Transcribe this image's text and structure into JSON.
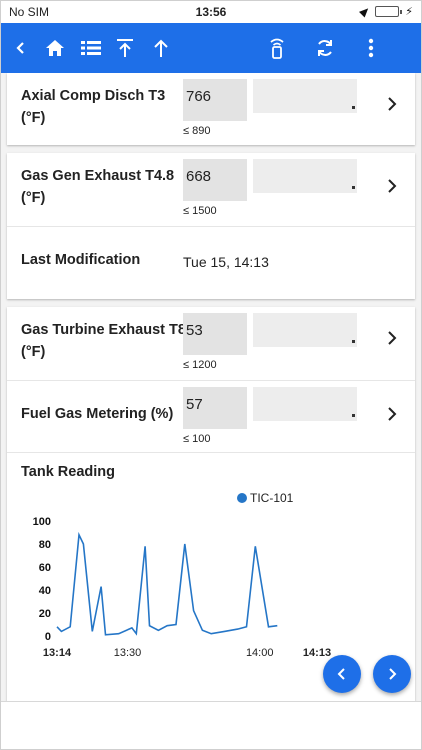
{
  "status": {
    "carrier": "No SIM",
    "time": "13:56"
  },
  "toolbar": {
    "items": [
      "back-icon",
      "home-icon",
      "list-icon",
      "scroll-top-icon",
      "arrow-up-icon",
      "beacon-icon",
      "sync-icon",
      "more-vertical-icon"
    ]
  },
  "card1": {
    "label_line1": "Axial Comp Disch T3",
    "label_line2": "(°F)",
    "value": "766",
    "limit": "≤ 890"
  },
  "card2": {
    "row1": {
      "label_line1": "Gas Gen Exhaust T4.8",
      "label_line2": "(°F)",
      "value": "668",
      "limit": "≤ 1500"
    },
    "row2": {
      "label": "Last Modification",
      "value": "Tue 15, 14:13"
    }
  },
  "card3": {
    "row1": {
      "label_line1": "Gas Turbine Exhaust T8",
      "label_line2": "(°F)",
      "value": "53",
      "limit": "≤ 1200"
    },
    "row2": {
      "label": "Fuel Gas Metering (%)",
      "value": "57",
      "limit": "≤ 100"
    },
    "chart_title": "Tank Reading"
  },
  "chart_data": {
    "type": "line",
    "title": "Tank Reading",
    "series": [
      {
        "name": "TIC-101",
        "color": "#2576c7",
        "x": [
          "13:14",
          "13:15",
          "13:17",
          "13:19",
          "13:20",
          "13:22",
          "13:24",
          "13:25",
          "13:28",
          "13:31",
          "13:32",
          "13:34",
          "13:35",
          "13:37",
          "13:39",
          "13:41",
          "13:43",
          "13:45",
          "13:47",
          "13:49",
          "13:52",
          "13:55",
          "13:57",
          "13:59",
          "14:02",
          "14:04",
          "14:06",
          "14:08",
          "14:09",
          "14:11",
          "14:13"
        ],
        "values": [
          8,
          4,
          8,
          88,
          80,
          4,
          43,
          1,
          2,
          7,
          2,
          78,
          9,
          5,
          9,
          10,
          80,
          22,
          5,
          2,
          4,
          6,
          8,
          78,
          8,
          9,
          null,
          null,
          null,
          null,
          null
        ]
      }
    ],
    "y_ticks": [
      "0",
      "20",
      "40",
      "60",
      "80",
      "100"
    ],
    "ylim": [
      0,
      100
    ],
    "x_ticks": [
      "13:14",
      "13:30",
      "14:00",
      "14:13"
    ],
    "legend_position": "top-right"
  }
}
